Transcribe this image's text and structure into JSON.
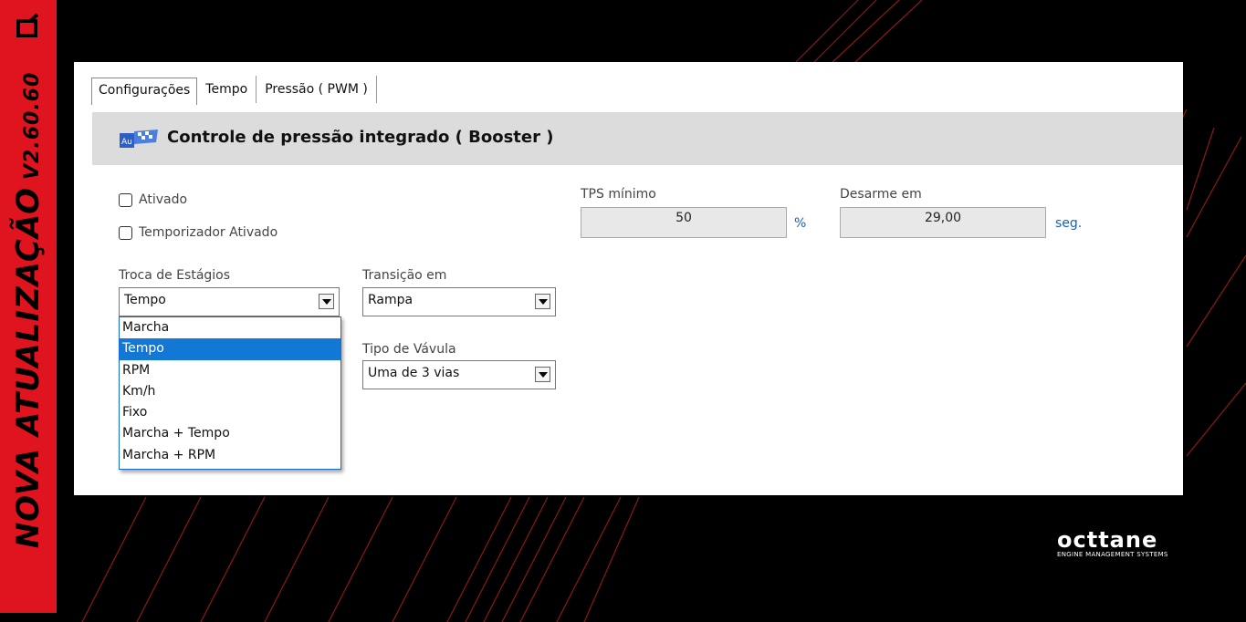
{
  "sidebar": {
    "title": "NOVA ATUALIZAÇÃO",
    "version": "V2.60.60"
  },
  "tabs": [
    {
      "label": "Configurações",
      "active": true
    },
    {
      "label": "Tempo",
      "active": false
    },
    {
      "label": "Pressão ( PWM )",
      "active": false
    }
  ],
  "header": {
    "title": "Controle de pressão integrado ( Booster )"
  },
  "checkboxes": {
    "ativado": {
      "label": "Ativado",
      "checked": false
    },
    "temporizador": {
      "label": "Temporizador Ativado",
      "checked": false
    }
  },
  "tps": {
    "label": "TPS mínimo",
    "value": "50",
    "unit": "%"
  },
  "desarme": {
    "label": "Desarme em",
    "value": "29,00",
    "unit": "seg."
  },
  "troca": {
    "label": "Troca de Estágios",
    "value": "Tempo",
    "options": [
      "Marcha",
      "Tempo",
      "RPM",
      "Km/h",
      "Fixo",
      "Marcha + Tempo",
      "Marcha + RPM"
    ],
    "selected_index": 1
  },
  "transicao": {
    "label": "Transição em",
    "value": "Rampa"
  },
  "valvula": {
    "label": "Tipo de Vávula",
    "value": "Uma de 3 vias"
  },
  "brand": {
    "name": "octtane",
    "tagline": "ENGINE MANAGEMENT SYSTEMS"
  },
  "colors": {
    "accent": "#e0141e",
    "selection": "#1377d6",
    "unit": "#1a5fb4"
  }
}
